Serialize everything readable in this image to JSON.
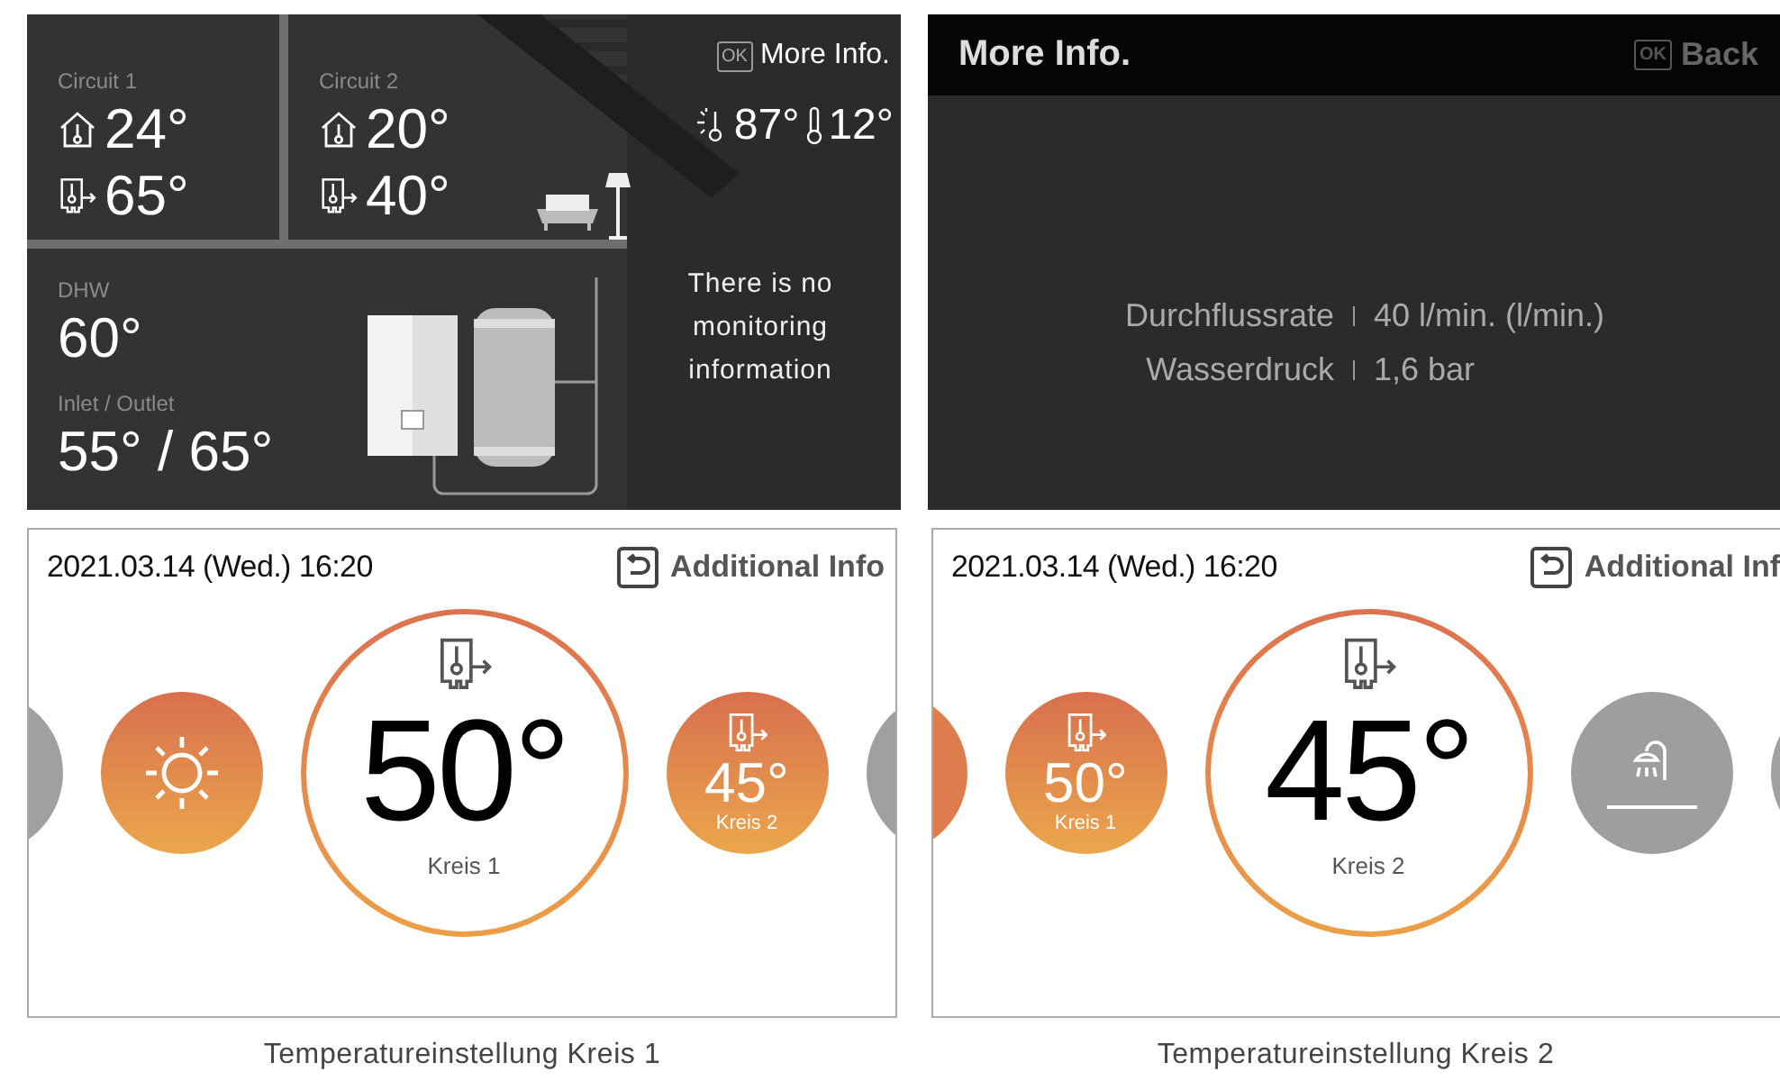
{
  "overview": {
    "circuits": [
      {
        "label": "Circuit 1",
        "room_temp": "24°",
        "flow_temp": "65°"
      },
      {
        "label": "Circuit 2",
        "room_temp": "20°",
        "flow_temp": "40°"
      }
    ],
    "dhw": {
      "label": "DHW",
      "value": "60°",
      "inlet_outlet_label": "Inlet / Outlet",
      "inlet_outlet": "55° / 65°"
    },
    "more_info": {
      "key": "OK",
      "label": "More Info."
    },
    "outdoor": {
      "sun_temp": "87°",
      "air_temp": "12°"
    },
    "message": "There is no monitoring information"
  },
  "more_info_screen": {
    "title": "More Info.",
    "back": {
      "key": "OK",
      "label": "Back"
    },
    "rows": [
      {
        "label": "Durchflussrate",
        "value": "40 l/min. (l/min.)"
      },
      {
        "label": "Wasserdruck",
        "value": "1,6 bar"
      }
    ]
  },
  "setting_screens": [
    {
      "datetime": "2021.03.14 (Wed.) 16:20",
      "info_button": "Additional Info",
      "caption": "Temperatureinstellung Kreis 1",
      "carousel": [
        {
          "kind": "edge",
          "color": "#a0a0a0"
        },
        {
          "kind": "mode"
        },
        {
          "kind": "focus",
          "value": "50°",
          "label": "Kreis 1"
        },
        {
          "kind": "circuit",
          "value": "45°",
          "label": "Kreis 2"
        },
        {
          "kind": "edge",
          "color": "#a0a0a0"
        }
      ]
    },
    {
      "datetime": "2021.03.14 (Wed.) 16:20",
      "info_button": "Additional Inf",
      "caption": "Temperatureinstellung Kreis 2",
      "carousel": [
        {
          "kind": "edge",
          "color": "#de7d4e"
        },
        {
          "kind": "circuit",
          "value": "50°",
          "label": "Kreis 1"
        },
        {
          "kind": "focus",
          "value": "45°",
          "label": "Kreis 2"
        },
        {
          "kind": "dhw"
        },
        {
          "kind": "edge",
          "color": "#a0a0a0"
        }
      ]
    }
  ]
}
